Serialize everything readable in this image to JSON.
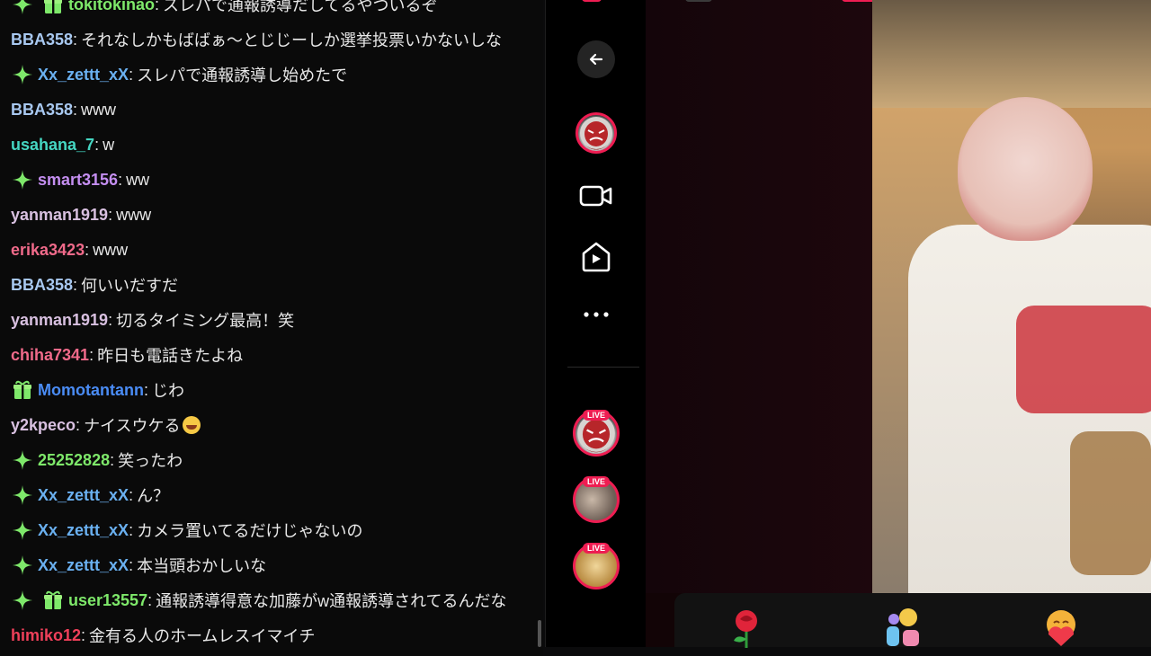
{
  "chat": {
    "messages": [
      {
        "badges": [
          "sparkle",
          "gift"
        ],
        "user": "tokitokinao",
        "user_color": "#7ee86a",
        "text": "スレパで通報誘導だしてるやついるぞ"
      },
      {
        "badges": [],
        "user": "BBA358",
        "user_color": "#a8c8f0",
        "text": "それなしかもばばぁ〜とじじーしか選挙投票いかないしな"
      },
      {
        "badges": [
          "sparkle"
        ],
        "user": "Xx_zettt_xX",
        "user_color": "#6ab0f0",
        "text": "スレパで通報誘導し始めたで"
      },
      {
        "badges": [],
        "user": "BBA358",
        "user_color": "#a8c8f0",
        "text": "www"
      },
      {
        "badges": [],
        "user": "usahana_7",
        "user_color": "#45d6c2",
        "text": "w"
      },
      {
        "badges": [
          "sparkle"
        ],
        "user": "smart3156",
        "user_color": "#c48ef0",
        "text": "ww"
      },
      {
        "badges": [],
        "user": "yanman1919",
        "user_color": "#d8c0e0",
        "text": "www"
      },
      {
        "badges": [],
        "user": "erika3423",
        "user_color": "#f06a8a",
        "text": "www"
      },
      {
        "badges": [],
        "user": "BBA358",
        "user_color": "#a8c8f0",
        "text": "何いいだすだ"
      },
      {
        "badges": [],
        "user": "yanman1919",
        "user_color": "#d8c0e0",
        "text": "切るタイミング最高！笑"
      },
      {
        "badges": [],
        "user": "chiha7341",
        "user_color": "#f06a8a",
        "text": "昨日も電話きたよね"
      },
      {
        "badges": [
          "gift"
        ],
        "user": "Momotantann",
        "user_color": "#4a8cf5",
        "text": "じわ"
      },
      {
        "badges": [],
        "user": "y2kpeco",
        "user_color": "#d8c0e0",
        "text": "ナイスウケる",
        "emoji": "rofl"
      },
      {
        "badges": [
          "sparkle"
        ],
        "user": "25252828",
        "user_color": "#7ee86a",
        "text": "笑ったわ"
      },
      {
        "badges": [
          "sparkle"
        ],
        "user": "Xx_zettt_xX",
        "user_color": "#6ab0f0",
        "text": "ん？"
      },
      {
        "badges": [
          "sparkle"
        ],
        "user": "Xx_zettt_xX",
        "user_color": "#6ab0f0",
        "text": "カメラ置いてるだけじゃないの"
      },
      {
        "badges": [
          "sparkle"
        ],
        "user": "Xx_zettt_xX",
        "user_color": "#6ab0f0",
        "text": "本当頭おかしいな"
      },
      {
        "badges": [
          "sparkle",
          "gift"
        ],
        "user": "user13557",
        "user_color": "#7ee86a",
        "text": "通報誘導得意な加藤がw通報誘導されてるんだな"
      },
      {
        "badges": [],
        "user": "himiko12",
        "user_color": "#f0405a",
        "text": "金有る人のホームレスイマイチ"
      }
    ]
  },
  "sidenav": {
    "back_icon": "back-arrow-icon",
    "items": [
      {
        "name": "profile-avatar",
        "live": false
      },
      {
        "name": "video-camera-icon"
      },
      {
        "name": "play-home-icon"
      },
      {
        "name": "more-dots-icon"
      }
    ],
    "live_label": "LIVE",
    "live_avatars": [
      "live-avatar-1",
      "live-avatar-2",
      "live-avatar-3"
    ]
  },
  "colors": {
    "accent": "#ee1d52",
    "sparkle_badge": "#7ee86a",
    "gift_badge": "#7ee86a"
  },
  "gifts": [
    "rose-gift-icon",
    "number-gift-icon",
    "heart-face-gift-icon"
  ]
}
